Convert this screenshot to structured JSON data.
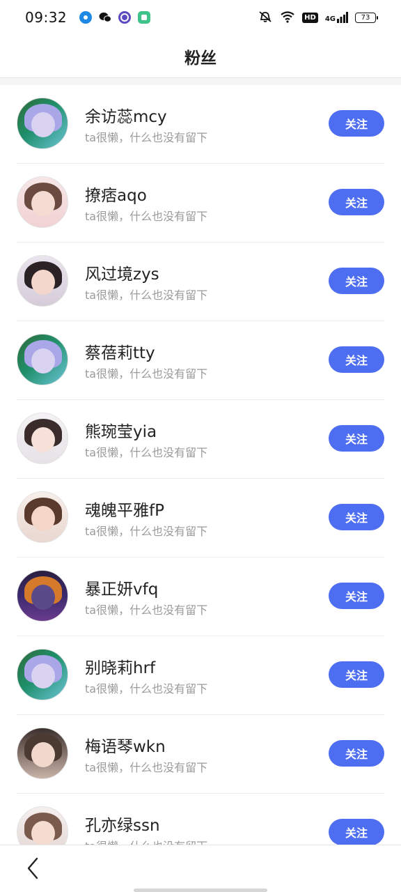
{
  "status_bar": {
    "time": "09:32",
    "network": "4G",
    "hd": "HD",
    "battery": "73",
    "icons": [
      "location-app-icon",
      "wechat-icon",
      "browser-app-icon",
      "notes-app-icon",
      "mute-icon",
      "wifi-icon",
      "signal-icon",
      "battery-icon"
    ]
  },
  "header": {
    "title": "粉丝"
  },
  "fans": [
    {
      "name": "余访蕊mcy",
      "bio": "ta很懒，什么也没有留下",
      "button": "关注",
      "avatar_style": "green-poster"
    },
    {
      "name": "撩痞aqo",
      "bio": "ta很懒，什么也没有留下",
      "button": "关注",
      "avatar_style": "pink-portrait"
    },
    {
      "name": "风过境zys",
      "bio": "ta很懒，什么也没有留下",
      "button": "关注",
      "avatar_style": "dark-hair-portrait"
    },
    {
      "name": "蔡蓓莉tty",
      "bio": "ta很懒，什么也没有留下",
      "button": "关注",
      "avatar_style": "green-poster"
    },
    {
      "name": "熊琬莹yia",
      "bio": "ta很懒，什么也没有留下",
      "button": "关注",
      "avatar_style": "light-portrait"
    },
    {
      "name": "魂魄平雅fP",
      "bio": "ta很懒，什么也没有留下",
      "button": "关注",
      "avatar_style": "brown-hair-portrait"
    },
    {
      "name": "暴正妍vfq",
      "bio": "ta很懒，什么也没有留下",
      "button": "关注",
      "avatar_style": "night-poster"
    },
    {
      "name": "别晓莉hrf",
      "bio": "ta很懒，什么也没有留下",
      "button": "关注",
      "avatar_style": "green-poster"
    },
    {
      "name": "梅语琴wkn",
      "bio": "ta很懒，什么也没有留下",
      "button": "关注",
      "avatar_style": "bunny-ears-portrait"
    },
    {
      "name": "孔亦绿ssn",
      "bio": "ta很懒，什么也没有留下",
      "button": "关注",
      "avatar_style": "hat-portrait"
    }
  ],
  "colors": {
    "accent": "#4e6ef2",
    "bio_text": "#9a9a9a",
    "divider": "#ececec"
  }
}
